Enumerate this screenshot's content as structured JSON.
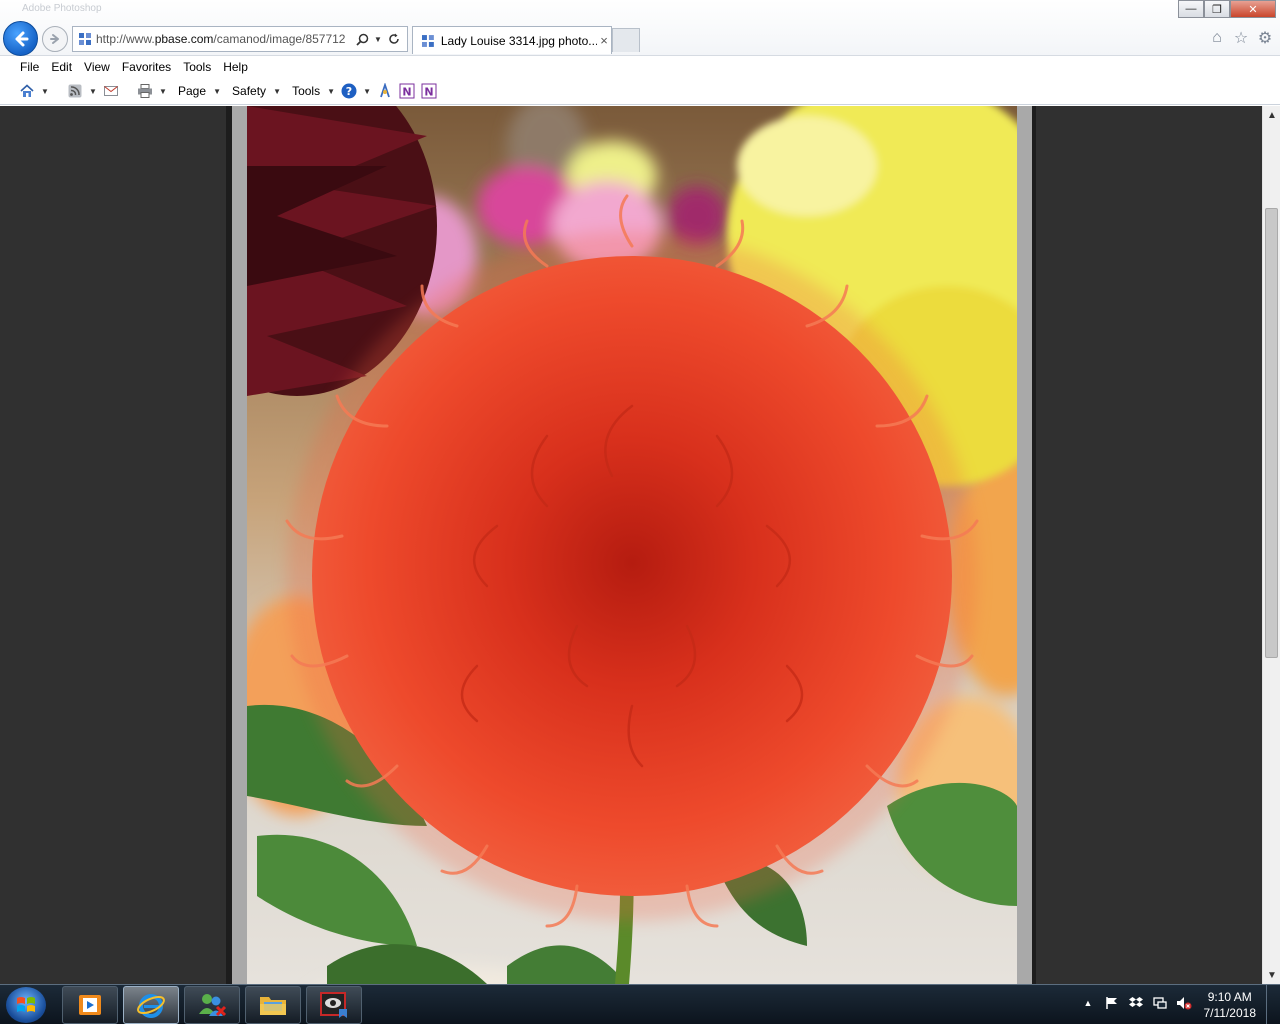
{
  "window": {
    "ghost_title": "Adobe Photoshop",
    "url_prefix": "http://www.",
    "url_domain": "pbase.com",
    "url_suffix": "/camanod/image/857712",
    "tab_title": "Lady Louise 3314.jpg photo...",
    "tab_close": "×",
    "minimize": "—",
    "restore": "❐",
    "close": "✕"
  },
  "menubar": [
    "File",
    "Edit",
    "View",
    "Favorites",
    "Tools",
    "Help"
  ],
  "commandbar": {
    "page": "Page",
    "safety": "Safety",
    "tools": "Tools"
  },
  "clock": {
    "time": "9:10 AM",
    "date": "7/11/2018"
  },
  "colors": {
    "ie_blue": "#1663c7",
    "page_bg": "#303030",
    "flower_red": "#e53a22",
    "flower_yellow": "#f0ea56",
    "taskbar": "#14202b"
  },
  "icons": [
    "back-icon",
    "forward-icon",
    "search-icon",
    "dropdown-icon",
    "refresh-icon",
    "home-icon",
    "star-icon",
    "gear-icon",
    "feeds-icon",
    "mail-icon",
    "print-icon",
    "help-icon",
    "onenote-icon"
  ]
}
